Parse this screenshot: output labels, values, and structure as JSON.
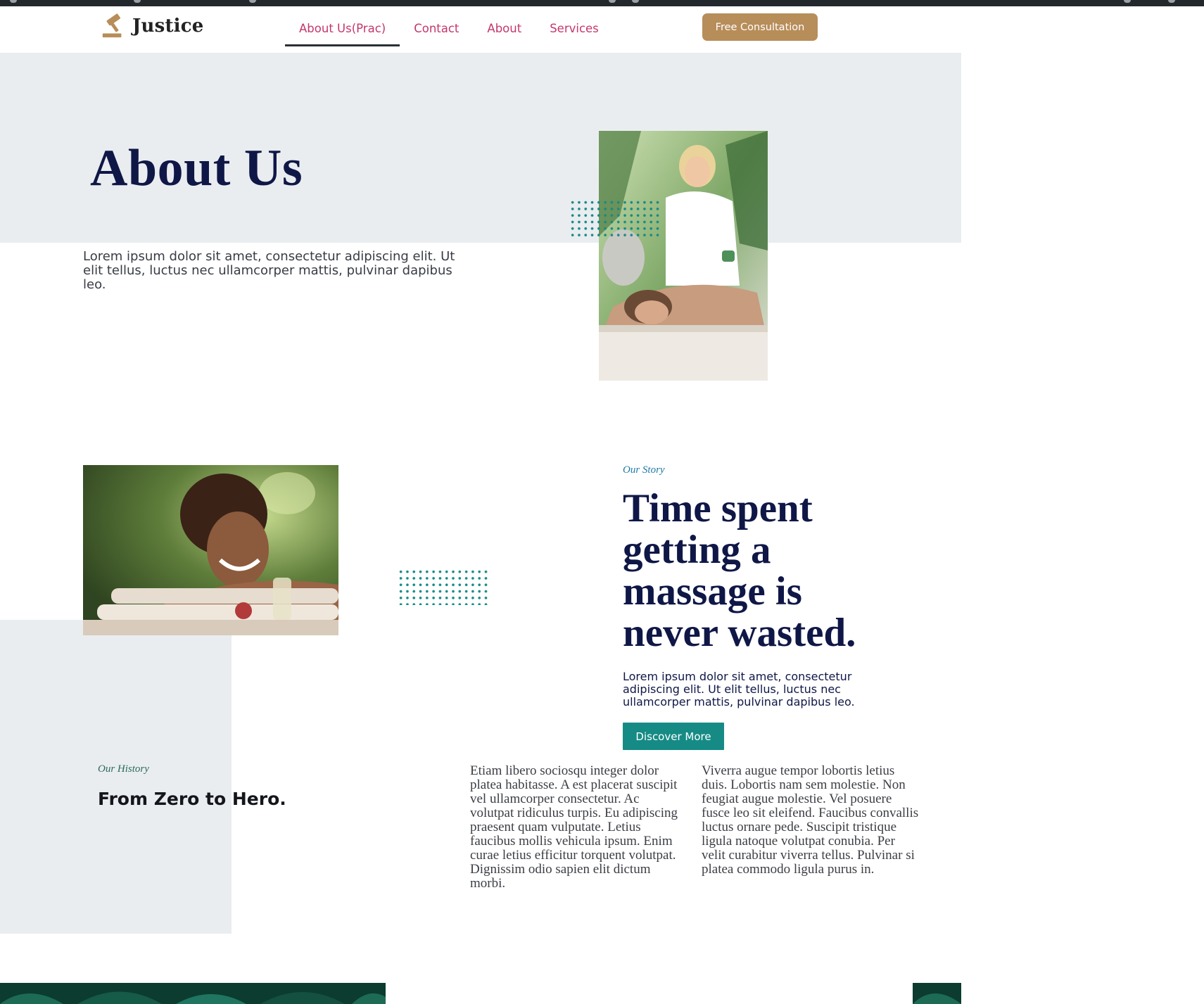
{
  "header": {
    "logo_text": "Justice",
    "nav": [
      {
        "label": "About Us(Prac)",
        "active": true
      },
      {
        "label": "Contact",
        "active": false
      },
      {
        "label": "About",
        "active": false
      },
      {
        "label": "Services",
        "active": false
      }
    ],
    "cta_label": "Free Consultation"
  },
  "hero": {
    "title": "About Us",
    "text": "Lorem ipsum dolor sit amet, consectetur adipiscing elit. Ut elit tellus, luctus nec ullamcorper mattis, pulvinar dapibus leo.",
    "image": "massage-therapist-photo"
  },
  "story": {
    "kicker": "Our Story",
    "heading": "Time spent getting a massage is never wasted.",
    "text": "Lorem ipsum dolor sit amet, consectetur adipiscing elit. Ut elit tellus, luctus nec ullamcorper mattis, pulvinar dapibus leo.",
    "button_label": "Discover More",
    "image": "smiling-woman-spa-photo"
  },
  "history": {
    "kicker": "Our History",
    "heading": "From Zero to Hero.",
    "col1": "Etiam libero sociosqu integer dolor platea habitasse. A est placerat suscipit vel ullamcorper consectetur. Ac volutpat ridiculus turpis. Eu adipiscing praesent quam vulputate. Letius faucibus mollis vehicula ipsum. Enim curae letius efficitur torquent volutpat. Dignissim odio sapien elit dictum morbi.",
    "col2": "Viverra augue tempor lobortis letius duis. Lobortis nam sem molestie. Non feugiat augue molestie. Vel posuere fusce leo sit eleifend. Faucibus convallis luctus ornare pede. Suscipit tristique ligula natoque volutpat conubia. Per velit curabitur viverra tellus. Pulvinar si platea commodo ligula purus in."
  },
  "colors": {
    "brand_gold": "#b78d5a",
    "nav_pink": "#c4376b",
    "heading_navy": "#0f1747",
    "teal": "#168b86",
    "band_gray": "#eaedf0"
  }
}
